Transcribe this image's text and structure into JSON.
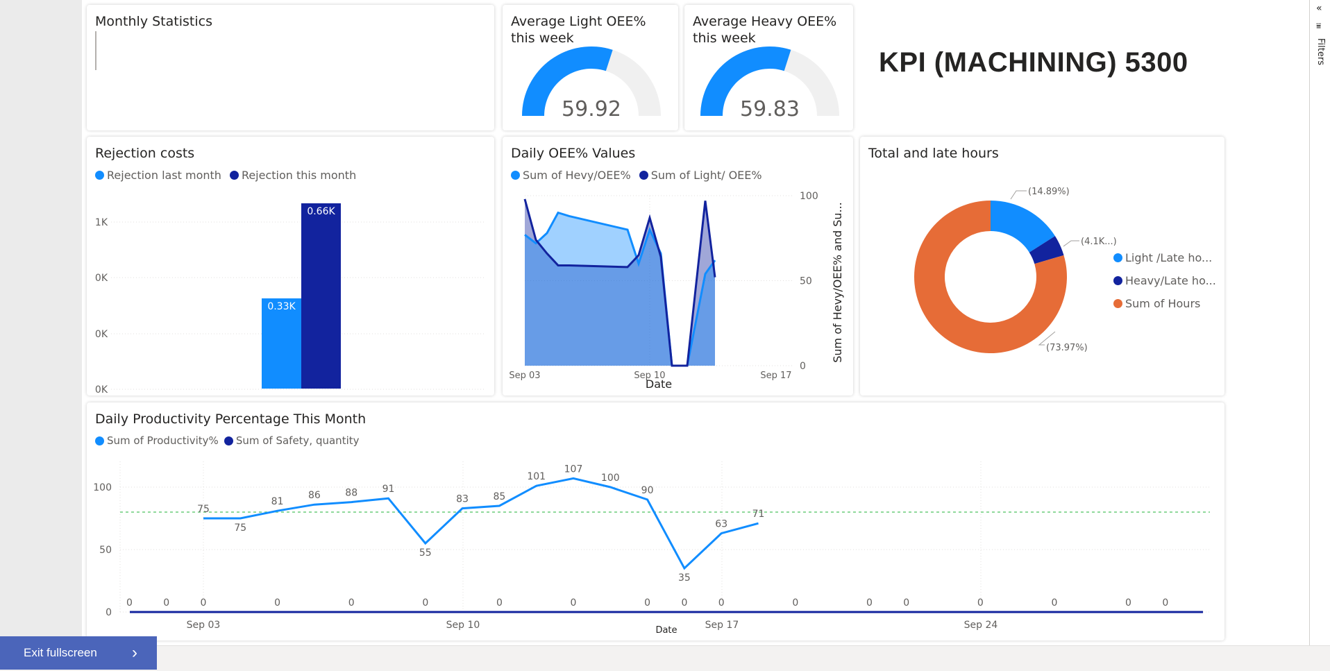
{
  "kpi_title": "KPI (MACHINING) 5300",
  "rail": {
    "filters_label": "Filters",
    "collapse_icon": "«",
    "filter_icon": "⩸"
  },
  "exit_fullscreen": {
    "label": "Exit fullscreen",
    "chevron": "›"
  },
  "monthly_stats": {
    "title": "Monthly Statistics"
  },
  "gauge_light": {
    "title_line1": "Average Light OEE%",
    "title_line2": "this week",
    "value_label": "59.92",
    "value": 59.92,
    "min": 0,
    "max": 100,
    "fill_color": "#118dff",
    "track_color": "#f0f0f0"
  },
  "gauge_heavy": {
    "title_line1": "Average Heavy OEE%",
    "title_line2": "this week",
    "value_label": "59.83",
    "value": 59.83,
    "min": 0,
    "max": 100,
    "fill_color": "#118dff",
    "track_color": "#f0f0f0"
  },
  "colors": {
    "light_blue": "#118dff",
    "dark_blue": "#12239e",
    "orange": "#e66c37",
    "green_dashed": "#8fd99b"
  },
  "rejection": {
    "title": "Rejection costs",
    "legend": [
      "Rejection last month",
      "Rejection this month"
    ],
    "y_ticks": [
      "1K",
      "0K",
      "0K",
      "0K"
    ],
    "bar_labels": [
      "0.33K",
      "0.66K"
    ]
  },
  "daily_oee": {
    "title": "Daily OEE% Values",
    "legend": [
      "Sum of Hevy/OEE%",
      "Sum of Light/ OEE%"
    ],
    "x_ticks": [
      "Sep 03",
      "Sep 10",
      "Sep 17"
    ],
    "y_ticks": [
      "100",
      "50",
      "0"
    ],
    "xlabel": "Date",
    "ylabel": "Sum of Hevy/OEE% and Su..."
  },
  "total_late": {
    "title": "Total and late hours",
    "legend": [
      "Light /Late ho...",
      "Heavy/Late ho...",
      "Sum of Hours"
    ],
    "labels": [
      "(14.89%)",
      "(4.1K...)",
      "(73.97%)"
    ]
  },
  "productivity": {
    "title": "Daily Productivity Percentage This Month",
    "legend": [
      "Sum of Productivity%",
      "Sum of Safety, quantity"
    ],
    "y_ticks": [
      "100",
      "50",
      "0"
    ],
    "x_ticks": [
      "Sep 03",
      "Sep 10",
      "Sep 17",
      "Sep 24"
    ],
    "xlabel": "Date"
  },
  "chart_data": [
    {
      "type": "bar",
      "title": "Rejection costs",
      "categories": [
        ""
      ],
      "series": [
        {
          "name": "Rejection last month",
          "values": [
            330
          ]
        },
        {
          "name": "Rejection this month",
          "values": [
            660
          ]
        }
      ],
      "data_labels": [
        "0.33K",
        "0.66K"
      ]
    },
    {
      "type": "area",
      "title": "Daily OEE% Values",
      "xlabel": "Date",
      "ylim": [
        0,
        100
      ],
      "x": [
        "Sep 03",
        "Sep 04",
        "Sep 05",
        "Sep 06",
        "Sep 07",
        "Sep 10",
        "Sep 11",
        "Sep 12",
        "Sep 13",
        "Sep 14",
        "Sep 15",
        "Sep 16",
        "Sep 17",
        "Sep 18",
        "Sep 19"
      ],
      "series": [
        {
          "name": "Sum of Hevy/OEE%",
          "values": [
            77,
            72,
            78,
            90,
            88,
            80,
            60,
            80,
            66,
            0,
            0,
            54,
            62,
            null,
            null
          ]
        },
        {
          "name": "Sum of Light/ OEE%",
          "values": [
            98,
            74,
            66,
            59,
            59,
            58,
            65,
            87,
            64,
            0,
            0,
            97,
            52,
            null,
            null
          ]
        }
      ]
    },
    {
      "type": "pie",
      "title": "Total and late hours",
      "labels": [
        "Light /Late ho...",
        "Heavy/Late ho...",
        "Sum of Hours"
      ],
      "values": [
        14.89,
        4.1,
        73.97
      ]
    },
    {
      "type": "line",
      "title": "Daily Productivity Percentage This Month",
      "xlabel": "Date",
      "ylim": [
        0,
        120
      ],
      "x": [
        "Sep 03",
        "Sep 04",
        "Sep 05",
        "Sep 06",
        "Sep 07",
        "Sep 08",
        "Sep 09",
        "Sep 10",
        "Sep 11",
        "Sep 12",
        "Sep 13",
        "Sep 14",
        "Sep 15",
        "Sep 16",
        "Sep 17",
        "Sep 18",
        "Sep 19",
        "Sep 20",
        "Sep 21",
        "Sep 22",
        "Sep 23",
        "Sep 24",
        "Sep 25",
        "Sep 26",
        "Sep 27",
        "Sep 28"
      ],
      "series": [
        {
          "name": "Sum of Productivity%",
          "values": [
            75,
            75,
            81,
            86,
            88,
            91,
            55,
            83,
            85,
            101,
            107,
            100,
            90,
            35,
            63,
            71,
            null,
            null,
            null,
            null,
            null,
            null,
            null,
            null,
            null,
            null
          ]
        },
        {
          "name": "Sum of Safety, quantity",
          "values": [
            0,
            0,
            0,
            0,
            0,
            0,
            0,
            0,
            0,
            0,
            0,
            0,
            0,
            0,
            0,
            0,
            0,
            0,
            0,
            0,
            0,
            0,
            0,
            0,
            0,
            0
          ]
        }
      ],
      "safety_label_dates": [
        "Sep 01",
        "Sep 02",
        "Sep 03",
        "Sep 05",
        "Sep 07",
        "Sep 09",
        "Sep 11",
        "Sep 13",
        "Sep 15",
        "Sep 16",
        "Sep 17",
        "Sep 19",
        "Sep 21",
        "Sep 22",
        "Sep 24",
        "Sep 26",
        "Sep 28",
        "Sep 29"
      ],
      "reference_line": 80
    }
  ]
}
